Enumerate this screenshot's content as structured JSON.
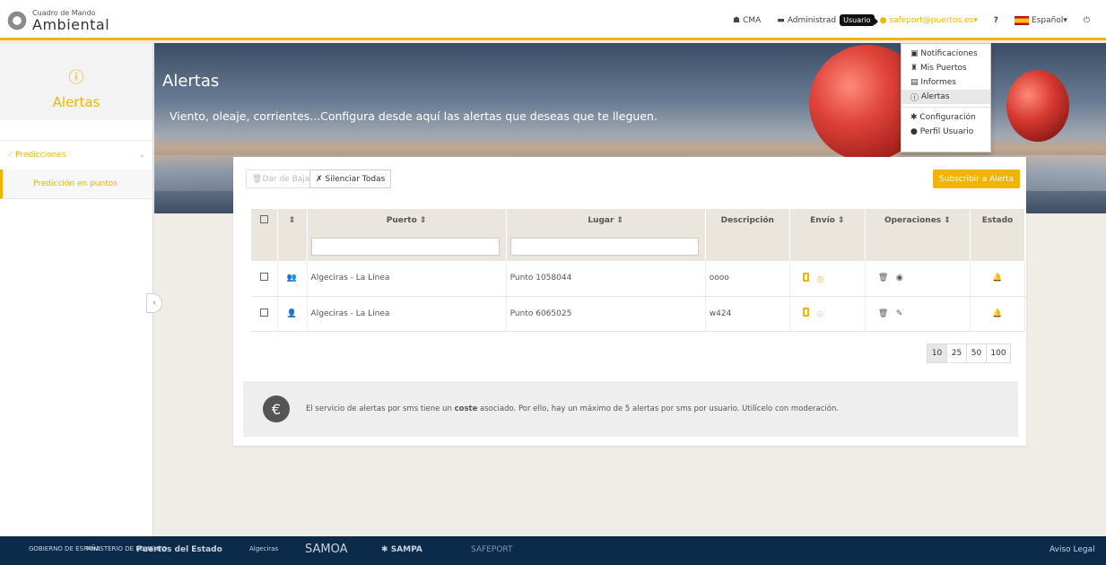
{
  "header": {
    "logo_small": "Cuadro de Mando",
    "logo_big": "Ambiental",
    "nav_cma": "CMA",
    "nav_admin": "Administrad",
    "tooltip": "Usuario",
    "user": "safeport@puertos.es",
    "help": "?",
    "language": "Español"
  },
  "menu": {
    "items": [
      "Notificaciones",
      "Mis Puertos",
      "Informes",
      "Alertas"
    ],
    "items2": [
      "Configuración",
      "Perfil Usuario"
    ]
  },
  "sidebar": {
    "title": "Alertas",
    "group": "Predicciones",
    "item": "Predicción en puntos"
  },
  "banner": {
    "title": "Alertas",
    "subtitle": "Viento, oleaje, corrientes...Configura desde aquí las alertas que deseas que te lleguen."
  },
  "toolbar": {
    "unsubscribe": "Dar de Baja",
    "silence": "Silenciar Todas",
    "subscribe": "Subscribir a Alerta"
  },
  "table": {
    "headers": [
      "Puerto",
      "Lugar",
      "Descripción",
      "Envío",
      "Operaciones",
      "Estado"
    ],
    "rows": [
      {
        "puerto": "Algeciras - La Línea",
        "lugar": "Punto 1058044",
        "desc": "oooo"
      },
      {
        "puerto": "Algeciras - La Línea",
        "lugar": "Punto 6065025",
        "desc": "w424"
      }
    ]
  },
  "pager": [
    "10",
    "25",
    "50",
    "100"
  ],
  "info": {
    "before": "El servicio de alertas por sms tiene un ",
    "bold": "coste",
    "after": " asociado. Por ello, hay un máximo de 5 alertas por sms por usuario. Utilícelo con moderación."
  },
  "footer": {
    "gob": "GOBIERNO DE ESPAÑA",
    "min": "MINISTERIO DE FOMENTO",
    "pde": "Puertos del Estado",
    "alg": "Algeciras",
    "samoa": "SAMOA",
    "sampa": "SAMPA",
    "safeport": "SAFEPORT",
    "legal": "Aviso Legal"
  }
}
